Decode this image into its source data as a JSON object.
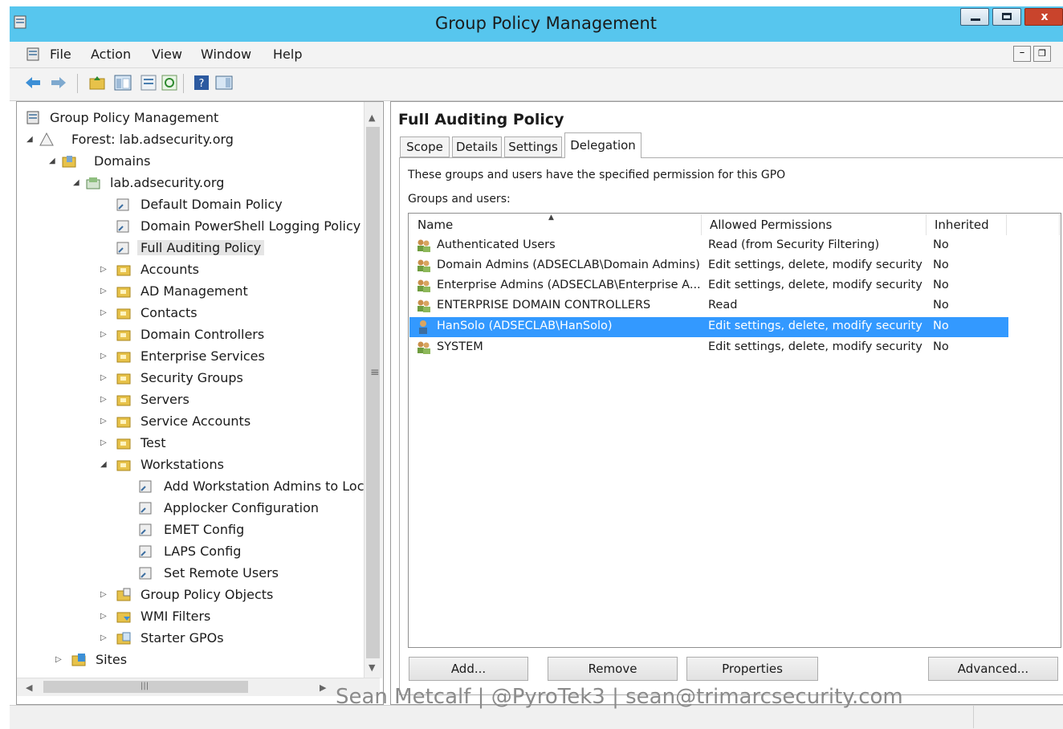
{
  "window": {
    "title": "Group Policy Management"
  },
  "menu": [
    "File",
    "Action",
    "View",
    "Window",
    "Help"
  ],
  "tree": {
    "root": "Group Policy Management",
    "forest": "Forest: lab.adsecurity.org",
    "domains": "Domains",
    "domain": "lab.adsecurity.org",
    "gpo_links": [
      "Default Domain Policy",
      "Domain PowerShell Logging Policy",
      "Full Auditing Policy"
    ],
    "ous": [
      "Accounts",
      "AD Management",
      "Contacts",
      "Domain Controllers",
      "Enterprise Services",
      "Security Groups",
      "Servers",
      "Service Accounts",
      "Test"
    ],
    "workstations": "Workstations",
    "workstation_gpos": [
      "Add Workstation Admins to Loc",
      "Applocker Configuration",
      "EMET Config",
      "LAPS Config",
      "Set Remote Users"
    ],
    "containers": [
      "Group Policy Objects",
      "WMI Filters",
      "Starter GPOs"
    ],
    "sites": "Sites",
    "selected": "Full Auditing Policy"
  },
  "details": {
    "title": "Full Auditing Policy",
    "tabs": [
      "Scope",
      "Details",
      "Settings",
      "Delegation"
    ],
    "active_tab": "Delegation",
    "description": "These groups and users have the specified permission for this GPO",
    "groups_label": "Groups and users:",
    "columns": [
      "Name",
      "Allowed Permissions",
      "Inherited"
    ],
    "rows": [
      {
        "name": "Authenticated Users",
        "permission": "Read (from Security Filtering)",
        "inherited": "No",
        "icon": "group-icon"
      },
      {
        "name": "Domain Admins (ADSECLAB\\Domain Admins)",
        "permission": "Edit settings, delete, modify security",
        "inherited": "No",
        "icon": "group-icon"
      },
      {
        "name": "Enterprise Admins (ADSECLAB\\Enterprise A...",
        "permission": "Edit settings, delete, modify security",
        "inherited": "No",
        "icon": "group-icon"
      },
      {
        "name": "ENTERPRISE DOMAIN CONTROLLERS",
        "permission": "Read",
        "inherited": "No",
        "icon": "group-icon"
      },
      {
        "name": "HanSolo (ADSECLAB\\HanSolo)",
        "permission": "Edit settings, delete, modify security",
        "inherited": "No",
        "icon": "user-icon",
        "selected": true
      },
      {
        "name": "SYSTEM",
        "permission": "Edit settings, delete, modify security",
        "inherited": "No",
        "icon": "group-icon"
      }
    ],
    "buttons": {
      "add": "Add...",
      "remove": "Remove",
      "properties": "Properties",
      "advanced": "Advanced..."
    }
  },
  "watermark": "Sean Metcalf | @PyroTek3 | sean@trimarcsecurity.com",
  "colors": {
    "titlebar": "#57c6ee",
    "selection": "#3399ff",
    "close": "#c9442c"
  }
}
